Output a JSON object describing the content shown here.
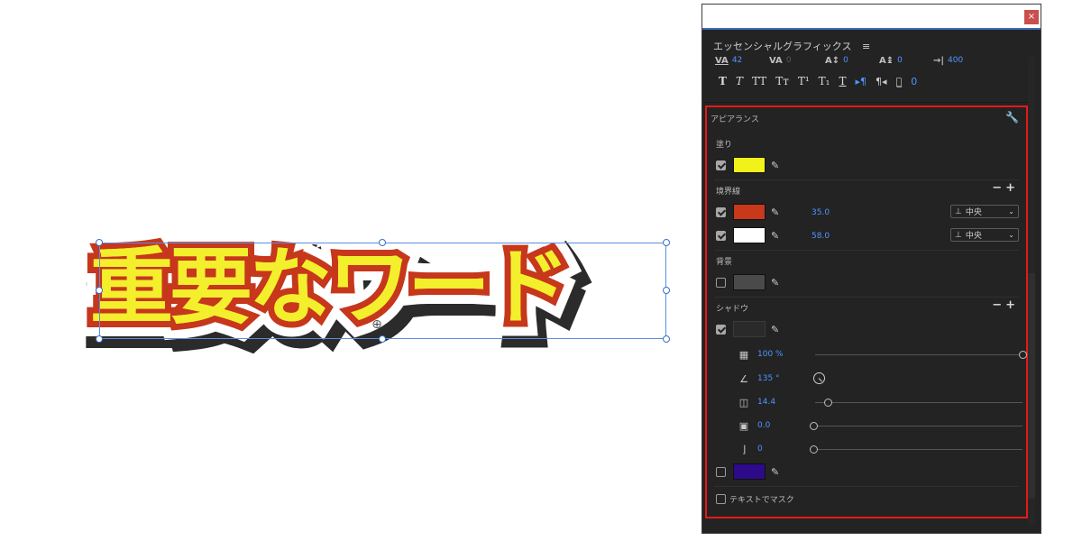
{
  "canvas": {
    "title_text": "重要なワード",
    "colors": {
      "fill": "#f4ef2c",
      "stroke1": "#c6371c",
      "stroke2": "#ffffff",
      "shadow": "#2b2b2b"
    }
  },
  "panel": {
    "title": "エッセンシャルグラフィックス",
    "menu_icon": "≡",
    "close_label": "×",
    "metrics": [
      {
        "icon": "VA",
        "value": "42",
        "dim": false
      },
      {
        "icon": "VA",
        "value": "0",
        "dim": true
      },
      {
        "icon": "A↕",
        "value": "0",
        "dim": false
      },
      {
        "icon": "A↨",
        "value": "0",
        "dim": false
      },
      {
        "icon": "→|",
        "value": "400",
        "dim": false
      }
    ],
    "format_buttons": [
      "T",
      "T",
      "TT",
      "Tт",
      "T¹",
      "T₁",
      "T"
    ],
    "paragraph_value": "0"
  },
  "appearance": {
    "label": "アピアランス",
    "fill": {
      "label": "塗り",
      "checked": true,
      "color": "#f1f21a"
    },
    "stroke": {
      "label": "境界線",
      "items": [
        {
          "checked": true,
          "color": "#c8381b",
          "width": "35.0",
          "position": "中央"
        },
        {
          "checked": true,
          "color": "#ffffff",
          "width": "58.0",
          "position": "中央"
        }
      ]
    },
    "background": {
      "label": "背景",
      "checked": false,
      "color": "#4a4a4a"
    },
    "shadow": {
      "label": "シャドウ",
      "checked": true,
      "color": "#2a2a2a",
      "opacity": "100 %",
      "angle": "135 °",
      "distance": "14.4",
      "size": "0.0",
      "blur": "0"
    },
    "extra": {
      "checked": false,
      "color": "#2c0a8a"
    },
    "mask_label": "テキストでマスク"
  }
}
